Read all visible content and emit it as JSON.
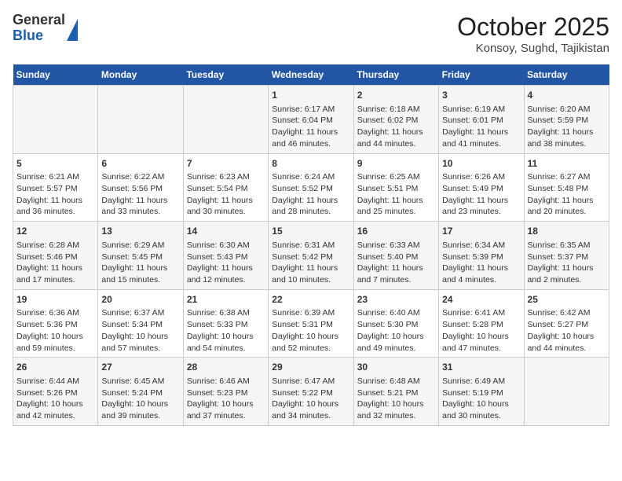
{
  "header": {
    "logo": {
      "general": "General",
      "blue": "Blue"
    },
    "title": "October 2025",
    "location": "Konsoy, Sughd, Tajikistan"
  },
  "days_of_week": [
    "Sunday",
    "Monday",
    "Tuesday",
    "Wednesday",
    "Thursday",
    "Friday",
    "Saturday"
  ],
  "weeks": [
    [
      {
        "day": "",
        "content": ""
      },
      {
        "day": "",
        "content": ""
      },
      {
        "day": "",
        "content": ""
      },
      {
        "day": "1",
        "content": "Sunrise: 6:17 AM\nSunset: 6:04 PM\nDaylight: 11 hours and 46 minutes."
      },
      {
        "day": "2",
        "content": "Sunrise: 6:18 AM\nSunset: 6:02 PM\nDaylight: 11 hours and 44 minutes."
      },
      {
        "day": "3",
        "content": "Sunrise: 6:19 AM\nSunset: 6:01 PM\nDaylight: 11 hours and 41 minutes."
      },
      {
        "day": "4",
        "content": "Sunrise: 6:20 AM\nSunset: 5:59 PM\nDaylight: 11 hours and 38 minutes."
      }
    ],
    [
      {
        "day": "5",
        "content": "Sunrise: 6:21 AM\nSunset: 5:57 PM\nDaylight: 11 hours and 36 minutes."
      },
      {
        "day": "6",
        "content": "Sunrise: 6:22 AM\nSunset: 5:56 PM\nDaylight: 11 hours and 33 minutes."
      },
      {
        "day": "7",
        "content": "Sunrise: 6:23 AM\nSunset: 5:54 PM\nDaylight: 11 hours and 30 minutes."
      },
      {
        "day": "8",
        "content": "Sunrise: 6:24 AM\nSunset: 5:52 PM\nDaylight: 11 hours and 28 minutes."
      },
      {
        "day": "9",
        "content": "Sunrise: 6:25 AM\nSunset: 5:51 PM\nDaylight: 11 hours and 25 minutes."
      },
      {
        "day": "10",
        "content": "Sunrise: 6:26 AM\nSunset: 5:49 PM\nDaylight: 11 hours and 23 minutes."
      },
      {
        "day": "11",
        "content": "Sunrise: 6:27 AM\nSunset: 5:48 PM\nDaylight: 11 hours and 20 minutes."
      }
    ],
    [
      {
        "day": "12",
        "content": "Sunrise: 6:28 AM\nSunset: 5:46 PM\nDaylight: 11 hours and 17 minutes."
      },
      {
        "day": "13",
        "content": "Sunrise: 6:29 AM\nSunset: 5:45 PM\nDaylight: 11 hours and 15 minutes."
      },
      {
        "day": "14",
        "content": "Sunrise: 6:30 AM\nSunset: 5:43 PM\nDaylight: 11 hours and 12 minutes."
      },
      {
        "day": "15",
        "content": "Sunrise: 6:31 AM\nSunset: 5:42 PM\nDaylight: 11 hours and 10 minutes."
      },
      {
        "day": "16",
        "content": "Sunrise: 6:33 AM\nSunset: 5:40 PM\nDaylight: 11 hours and 7 minutes."
      },
      {
        "day": "17",
        "content": "Sunrise: 6:34 AM\nSunset: 5:39 PM\nDaylight: 11 hours and 4 minutes."
      },
      {
        "day": "18",
        "content": "Sunrise: 6:35 AM\nSunset: 5:37 PM\nDaylight: 11 hours and 2 minutes."
      }
    ],
    [
      {
        "day": "19",
        "content": "Sunrise: 6:36 AM\nSunset: 5:36 PM\nDaylight: 10 hours and 59 minutes."
      },
      {
        "day": "20",
        "content": "Sunrise: 6:37 AM\nSunset: 5:34 PM\nDaylight: 10 hours and 57 minutes."
      },
      {
        "day": "21",
        "content": "Sunrise: 6:38 AM\nSunset: 5:33 PM\nDaylight: 10 hours and 54 minutes."
      },
      {
        "day": "22",
        "content": "Sunrise: 6:39 AM\nSunset: 5:31 PM\nDaylight: 10 hours and 52 minutes."
      },
      {
        "day": "23",
        "content": "Sunrise: 6:40 AM\nSunset: 5:30 PM\nDaylight: 10 hours and 49 minutes."
      },
      {
        "day": "24",
        "content": "Sunrise: 6:41 AM\nSunset: 5:28 PM\nDaylight: 10 hours and 47 minutes."
      },
      {
        "day": "25",
        "content": "Sunrise: 6:42 AM\nSunset: 5:27 PM\nDaylight: 10 hours and 44 minutes."
      }
    ],
    [
      {
        "day": "26",
        "content": "Sunrise: 6:44 AM\nSunset: 5:26 PM\nDaylight: 10 hours and 42 minutes."
      },
      {
        "day": "27",
        "content": "Sunrise: 6:45 AM\nSunset: 5:24 PM\nDaylight: 10 hours and 39 minutes."
      },
      {
        "day": "28",
        "content": "Sunrise: 6:46 AM\nSunset: 5:23 PM\nDaylight: 10 hours and 37 minutes."
      },
      {
        "day": "29",
        "content": "Sunrise: 6:47 AM\nSunset: 5:22 PM\nDaylight: 10 hours and 34 minutes."
      },
      {
        "day": "30",
        "content": "Sunrise: 6:48 AM\nSunset: 5:21 PM\nDaylight: 10 hours and 32 minutes."
      },
      {
        "day": "31",
        "content": "Sunrise: 6:49 AM\nSunset: 5:19 PM\nDaylight: 10 hours and 30 minutes."
      },
      {
        "day": "",
        "content": ""
      }
    ]
  ]
}
